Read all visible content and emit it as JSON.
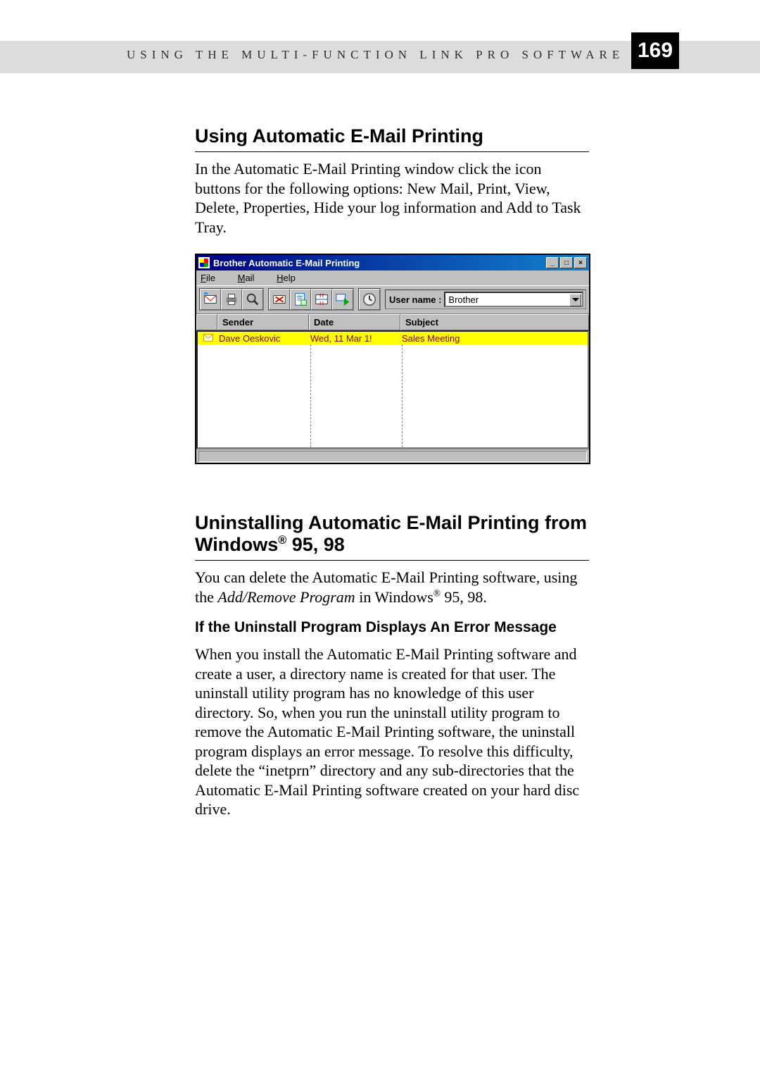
{
  "header": {
    "running_title": "USING THE MULTI-FUNCTION LINK PRO SOFTWARE",
    "page_number": "169"
  },
  "section1": {
    "title": "Using Automatic E-Mail Printing",
    "para": "In the Automatic E-Mail Printing window click the icon buttons for the following options: New Mail, Print, View, Delete, Properties, Hide your log information and Add to Task Tray."
  },
  "window": {
    "title": "Brother Automatic E-Mail Printing",
    "controls": {
      "min": "_",
      "max": "□",
      "close": "×"
    },
    "menu": {
      "file": "File",
      "mail": "Mail",
      "help": "Help"
    },
    "toolbar_icons": [
      "new-mail-icon",
      "print-icon",
      "view-icon",
      "delete-icon",
      "properties-icon",
      "hide-log-icon",
      "task-tray-icon",
      "clock-icon"
    ],
    "user_label": "User name :",
    "user_value": "Brother",
    "columns": {
      "sender": "Sender",
      "date": "Date",
      "subject": "Subject"
    },
    "row": {
      "sender": "Dave Oeskovic",
      "date": "Wed, 11 Mar 1!",
      "subject": "Sales Meeting"
    }
  },
  "section2": {
    "title_a": "Uninstalling Automatic E-Mail Printing from Windows",
    "title_b": " 95, 98",
    "para_a": "You can delete the Automatic E-Mail Printing software, using the ",
    "para_b": "Add/Remove Program",
    "para_c": " in Windows",
    "para_d": " 95, 98.",
    "sub": "If the Uninstall Program Displays An Error Message",
    "para2": "When you install the Automatic E-Mail Printing software and create a user, a directory name is created for that user. The uninstall utility program has no knowledge of this user directory. So, when you run the uninstall utility program to remove the Automatic E-Mail Printing software, the uninstall program displays an error message. To resolve this difficulty, delete the “inetprn” directory and any sub-directories that the Automatic E-Mail Printing software created on your hard disc drive."
  }
}
